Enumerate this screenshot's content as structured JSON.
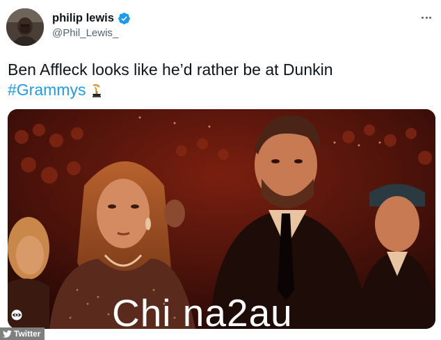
{
  "author": {
    "display_name": "philip lewis",
    "handle": "@Phil_Lewis_",
    "verified": true
  },
  "tweet": {
    "text_line1": "Ben Affleck looks like he’d rather be at Dunkin",
    "hashtag": "#Grammys",
    "hashtag_icon": "grammy-trophy-icon"
  },
  "media": {
    "watermark_text": "Chi na2au",
    "corner_logo": "cbs-eye-icon"
  },
  "source_badge": {
    "label": "Twitter",
    "icon": "twitter-bird-icon"
  },
  "colors": {
    "link": "#1d9bf0",
    "text": "#0f1419",
    "secondary": "#536471",
    "verified": "#1d9bf0"
  }
}
